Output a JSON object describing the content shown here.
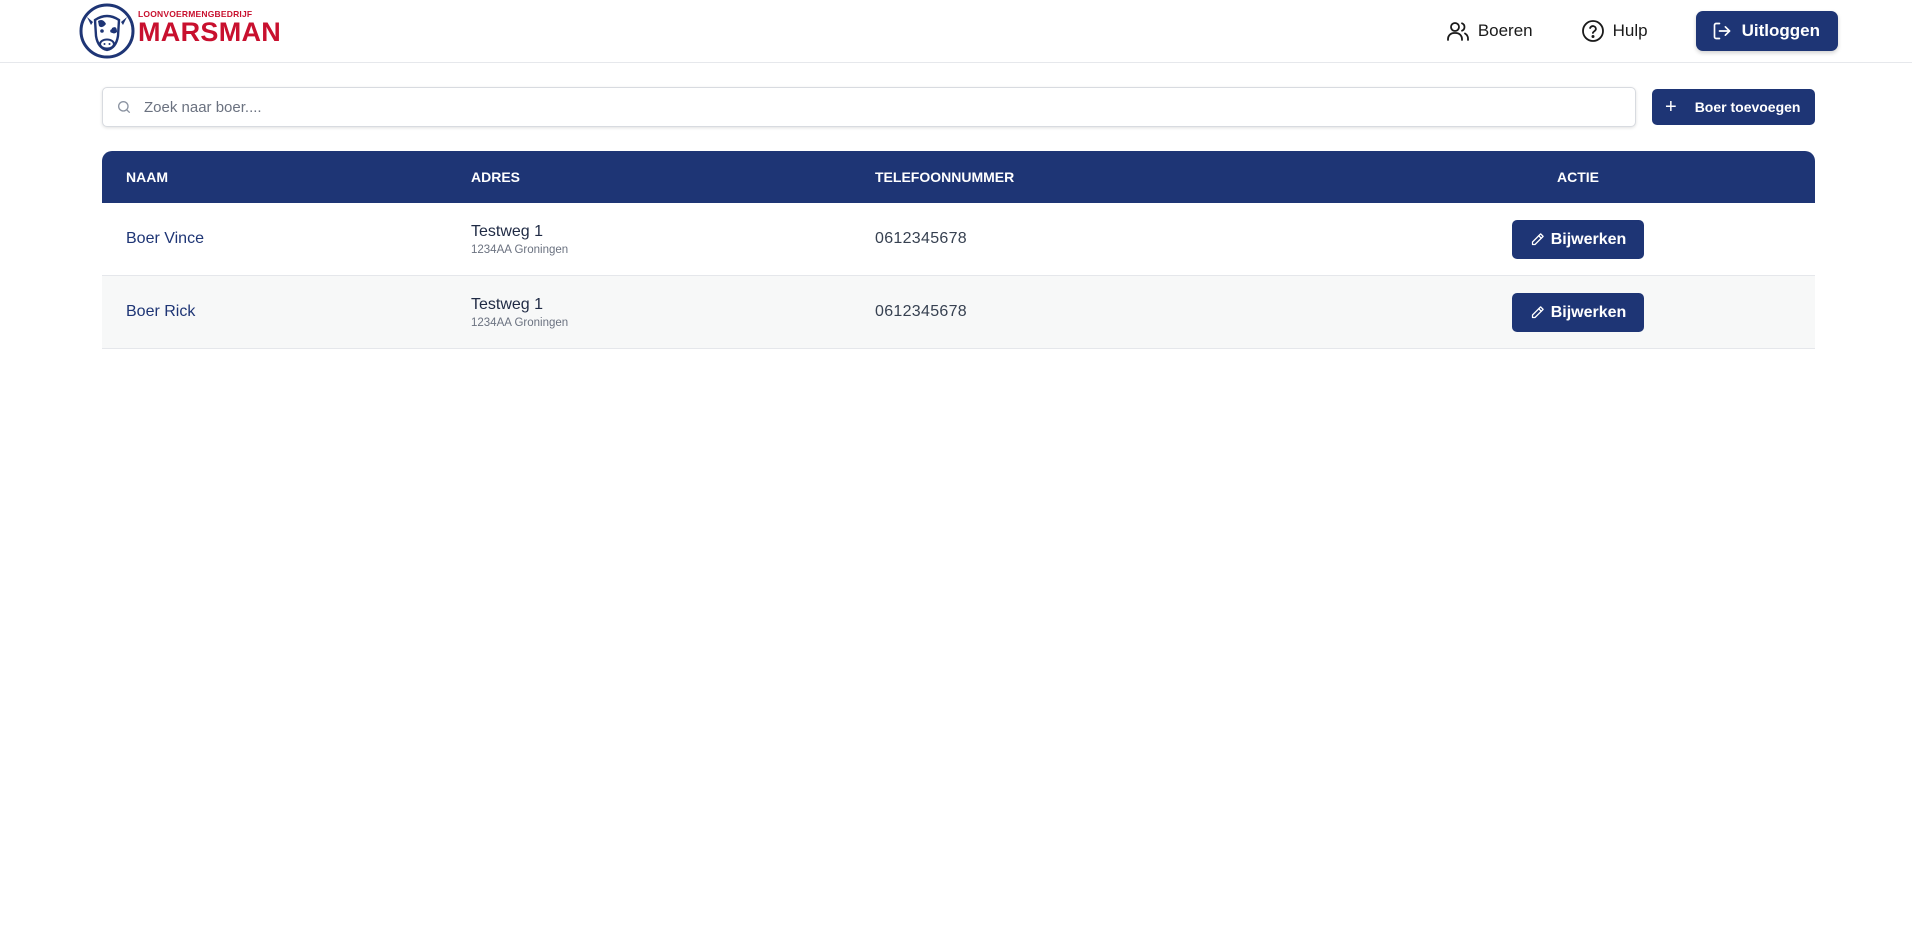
{
  "brand": {
    "subtitle": "LOONVOERMENGBEDRIJF",
    "name": "MARSMAN",
    "color": "#c8102e"
  },
  "nav": {
    "farmers_label": "Boeren",
    "farmers_icon": "users-icon",
    "help_label": "Hulp",
    "help_icon": "help-circle-icon",
    "logout_label": "Uitloggen",
    "logout_icon": "logout-icon"
  },
  "search": {
    "placeholder": "Zoek naar boer....",
    "value": ""
  },
  "add_button": {
    "label": "Boer toevoegen",
    "icon": "plus-icon"
  },
  "table": {
    "columns": [
      "NAAM",
      "ADRES",
      "TELEFOONNUMMER",
      "ACTIE"
    ],
    "rows": [
      {
        "name": "Boer Vince",
        "street": "Testweg 1",
        "city": "1234AA Groningen",
        "phone": "0612345678",
        "action_label": "Bijwerken"
      },
      {
        "name": "Boer Rick",
        "street": "Testweg 1",
        "city": "1234AA Groningen",
        "phone": "0612345678",
        "action_label": "Bijwerken"
      }
    ]
  },
  "colors": {
    "primary": "#1e3575",
    "brand_red": "#c8102e",
    "row_alt": "#f7f8f8"
  }
}
